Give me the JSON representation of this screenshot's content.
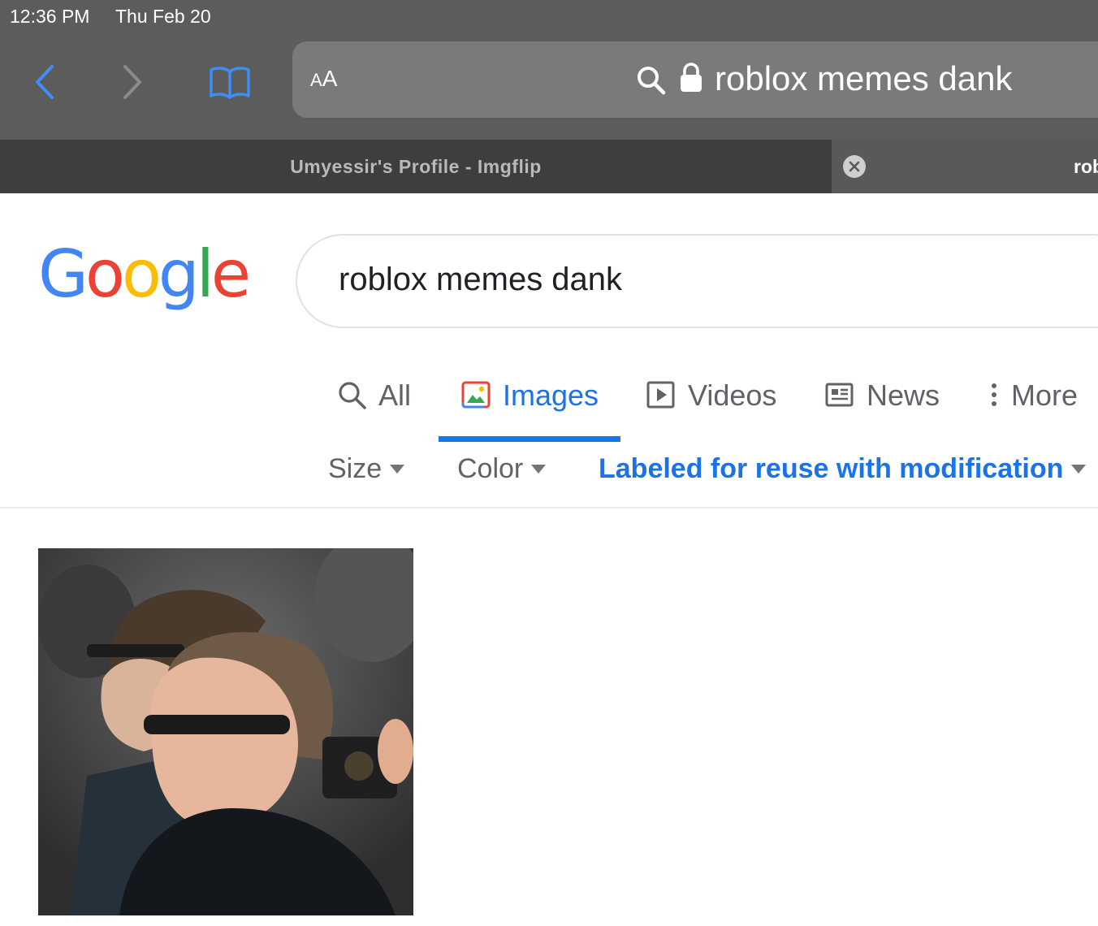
{
  "status_bar": {
    "time": "12:36 PM",
    "date": "Thu Feb 20"
  },
  "toolbar": {
    "reader_label_small": "A",
    "reader_label_large": "A",
    "address_text": "roblox memes dank"
  },
  "tabs_bar": {
    "tab1_title": "Umyessir's Profile - Imgflip",
    "tab2_title": "roblox memes dank"
  },
  "google": {
    "logo": [
      "G",
      "o",
      "o",
      "g",
      "l",
      "e"
    ],
    "colors": {
      "blue": "#4285F4",
      "red": "#EA4335",
      "yellow": "#FBBC05",
      "green": "#34A853",
      "accent": "#1a73e8"
    }
  },
  "search": {
    "query": "roblox memes dank"
  },
  "search_tabs": [
    {
      "label": "All",
      "icon": "search-icon",
      "active": false
    },
    {
      "label": "Images",
      "icon": "image-icon",
      "active": true
    },
    {
      "label": "Videos",
      "icon": "video-icon",
      "active": false
    },
    {
      "label": "News",
      "icon": "news-icon",
      "active": false
    },
    {
      "label": "More",
      "icon": "more-vertical-icon",
      "active": false
    }
  ],
  "filters": {
    "size": "Size",
    "color": "Color",
    "usage_rights": "Labeled for reuse with modification"
  }
}
